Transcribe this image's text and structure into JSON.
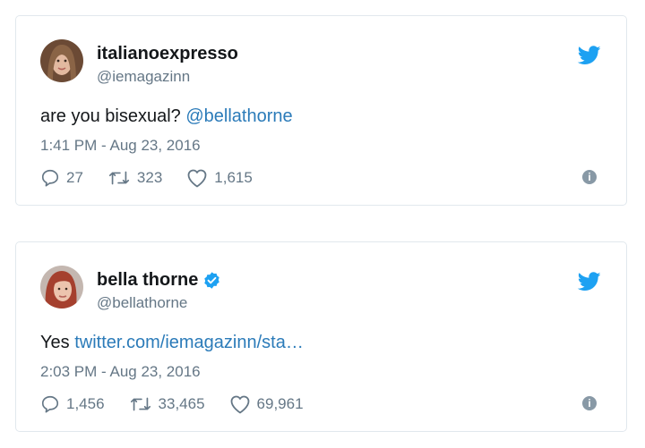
{
  "tweets": [
    {
      "display_name": "italianoexpresso",
      "handle": "@iemagazinn",
      "verified": false,
      "text_prefix": "are you bisexual? ",
      "text_link": "@bellathorne",
      "timestamp": "1:41 PM - Aug 23, 2016",
      "replies": "27",
      "retweets": "323",
      "likes": "1,615"
    },
    {
      "display_name": "bella thorne",
      "handle": "@bellathorne",
      "verified": true,
      "text_prefix": "Yes ",
      "text_link": "twitter.com/iemagazinn/sta…",
      "timestamp": "2:03 PM - Aug 23, 2016",
      "replies": "1,456",
      "retweets": "33,465",
      "likes": "69,961"
    }
  ],
  "icons": {
    "brand": "twitter-bird-icon",
    "reply": "reply-icon",
    "retweet": "retweet-icon",
    "like": "heart-icon",
    "info": "info-icon",
    "verified": "verified-badge-icon"
  },
  "colors": {
    "link": "#2b7bb9",
    "brand_blue": "#1da1f2",
    "muted": "#657786",
    "border": "#e1e8ed"
  }
}
